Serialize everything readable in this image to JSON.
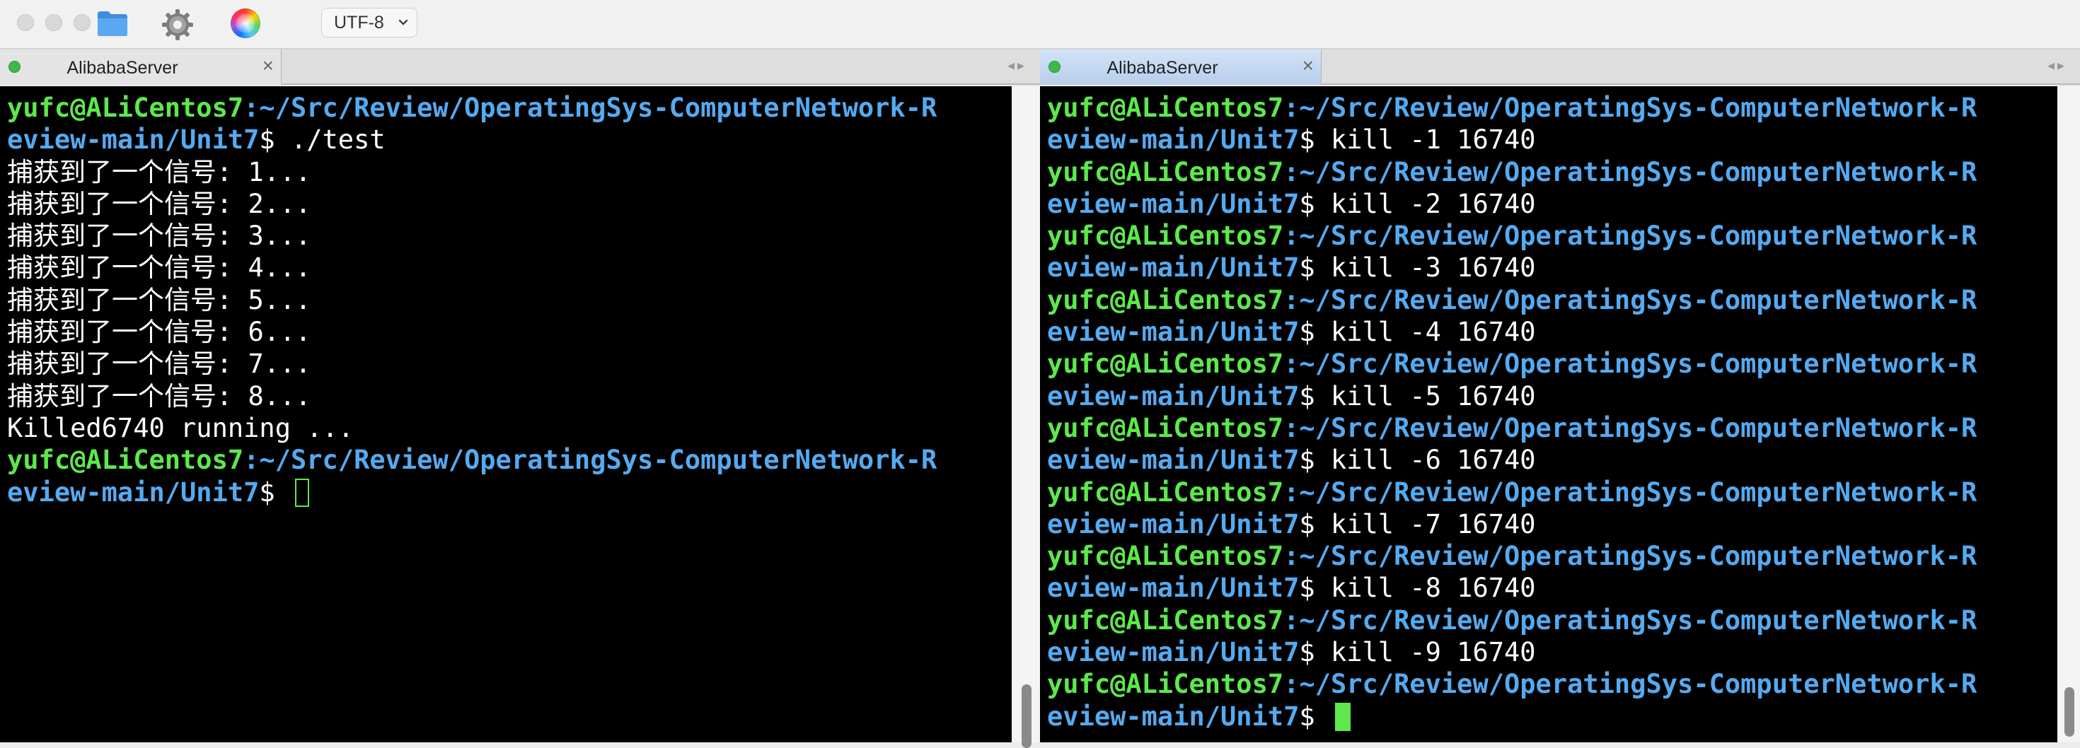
{
  "toolbar": {
    "encoding": "UTF-8",
    "icons": [
      "folder-icon",
      "gear-icon",
      "color-picker-icon"
    ]
  },
  "left_pane": {
    "tab_title": "AlibabaServer",
    "terminal": [
      {
        "user": "yufc@ALiCentos7",
        "path": ":~/Src/Review/OperatingSys-ComputerNetwork-R"
      },
      {
        "path": "eview-main/Unit7",
        "rest": "$ ./test"
      },
      {
        "text": "捕获到了一个信号: 1..."
      },
      {
        "text": "捕获到了一个信号: 2..."
      },
      {
        "text": "捕获到了一个信号: 3..."
      },
      {
        "text": "捕获到了一个信号: 4..."
      },
      {
        "text": "捕获到了一个信号: 5..."
      },
      {
        "text": "捕获到了一个信号: 6..."
      },
      {
        "text": "捕获到了一个信号: 7..."
      },
      {
        "text": "捕获到了一个信号: 8..."
      },
      {
        "text": "Killed6740 running ..."
      },
      {
        "user": "yufc@ALiCentos7",
        "path": ":~/Src/Review/OperatingSys-ComputerNetwork-R"
      },
      {
        "path": "eview-main/Unit7",
        "rest": "$ ",
        "cursor": "hollow"
      }
    ]
  },
  "right_pane": {
    "tab_title": "AlibabaServer",
    "terminal": [
      {
        "user": "yufc@ALiCentos7",
        "path": ":~/Src/Review/OperatingSys-ComputerNetwork-R"
      },
      {
        "path": "eview-main/Unit7",
        "rest": "$ kill -1 16740"
      },
      {
        "user": "yufc@ALiCentos7",
        "path": ":~/Src/Review/OperatingSys-ComputerNetwork-R"
      },
      {
        "path": "eview-main/Unit7",
        "rest": "$ kill -2 16740"
      },
      {
        "user": "yufc@ALiCentos7",
        "path": ":~/Src/Review/OperatingSys-ComputerNetwork-R"
      },
      {
        "path": "eview-main/Unit7",
        "rest": "$ kill -3 16740"
      },
      {
        "user": "yufc@ALiCentos7",
        "path": ":~/Src/Review/OperatingSys-ComputerNetwork-R"
      },
      {
        "path": "eview-main/Unit7",
        "rest": "$ kill -4 16740"
      },
      {
        "user": "yufc@ALiCentos7",
        "path": ":~/Src/Review/OperatingSys-ComputerNetwork-R"
      },
      {
        "path": "eview-main/Unit7",
        "rest": "$ kill -5 16740"
      },
      {
        "user": "yufc@ALiCentos7",
        "path": ":~/Src/Review/OperatingSys-ComputerNetwork-R"
      },
      {
        "path": "eview-main/Unit7",
        "rest": "$ kill -6 16740"
      },
      {
        "user": "yufc@ALiCentos7",
        "path": ":~/Src/Review/OperatingSys-ComputerNetwork-R"
      },
      {
        "path": "eview-main/Unit7",
        "rest": "$ kill -7 16740"
      },
      {
        "user": "yufc@ALiCentos7",
        "path": ":~/Src/Review/OperatingSys-ComputerNetwork-R"
      },
      {
        "path": "eview-main/Unit7",
        "rest": "$ kill -8 16740"
      },
      {
        "user": "yufc@ALiCentos7",
        "path": ":~/Src/Review/OperatingSys-ComputerNetwork-R"
      },
      {
        "path": "eview-main/Unit7",
        "rest": "$ kill -9 16740"
      },
      {
        "user": "yufc@ALiCentos7",
        "path": ":~/Src/Review/OperatingSys-ComputerNetwork-R"
      },
      {
        "path": "eview-main/Unit7",
        "rest": "$ ",
        "cursor": "solid"
      }
    ]
  },
  "colors": {
    "user": "#5ee84c",
    "path": "#55aaf0",
    "text": "#ffffff",
    "background": "#000000"
  }
}
